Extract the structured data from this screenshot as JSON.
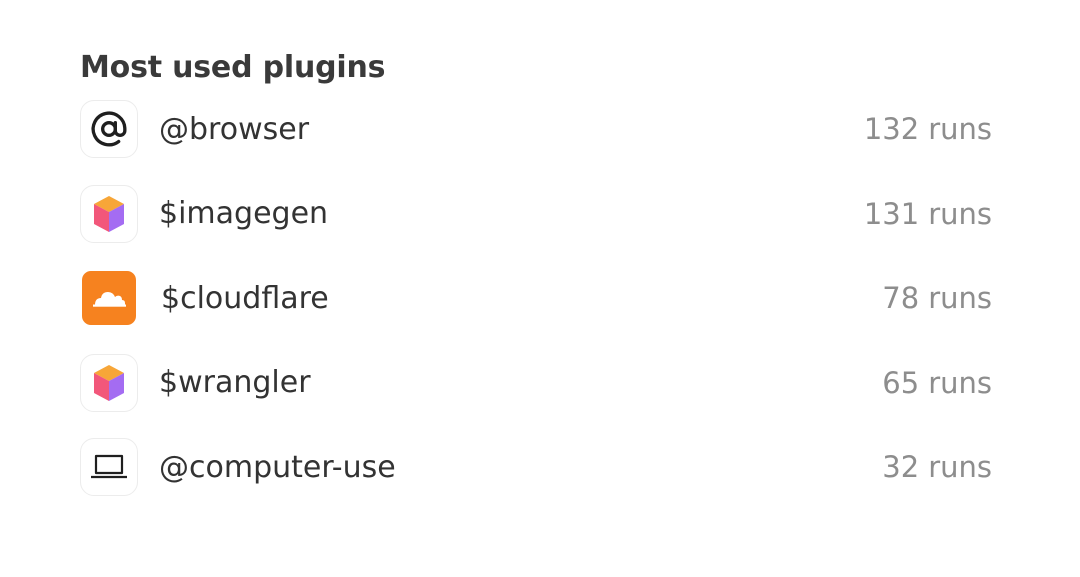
{
  "section": {
    "title": "Most used plugins"
  },
  "plugins": [
    {
      "name": "@browser",
      "count": "132",
      "unit": "runs",
      "icon": "at-sign-icon"
    },
    {
      "name": "$imagegen",
      "count": "131",
      "unit": "runs",
      "icon": "cube-icon"
    },
    {
      "name": "$cloudflare",
      "count": "78",
      "unit": "runs",
      "icon": "cloudflare-icon"
    },
    {
      "name": "$wrangler",
      "count": "65",
      "unit": "runs",
      "icon": "cube-icon"
    },
    {
      "name": "@computer-use",
      "count": "32",
      "unit": "runs",
      "icon": "laptop-icon"
    }
  ],
  "colors": {
    "cloudflare_orange": "#F6821F",
    "cube_orange": "#F7A638",
    "cube_pink": "#F2577A",
    "cube_purple": "#A46CF2"
  }
}
